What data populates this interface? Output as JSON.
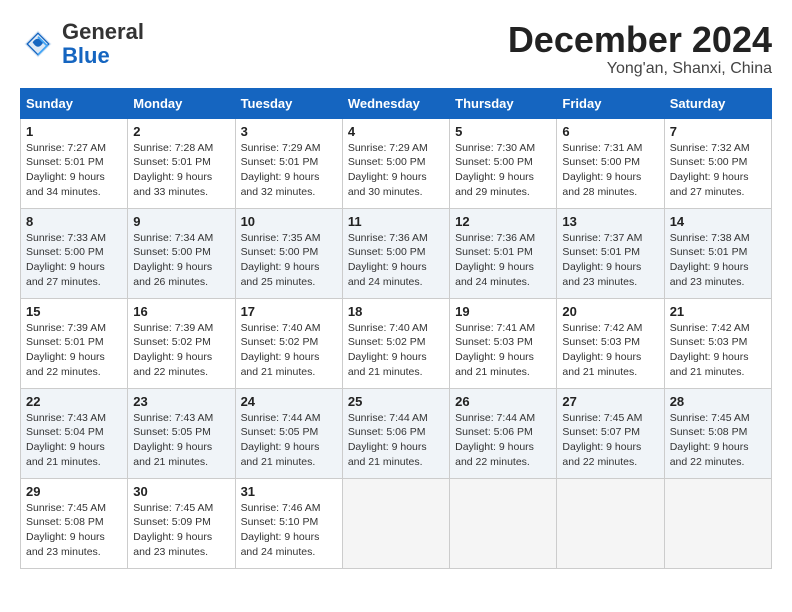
{
  "header": {
    "logo_line1": "General",
    "logo_line2": "Blue",
    "month_title": "December 2024",
    "location": "Yong'an, Shanxi, China"
  },
  "weekdays": [
    "Sunday",
    "Monday",
    "Tuesday",
    "Wednesday",
    "Thursday",
    "Friday",
    "Saturday"
  ],
  "weeks": [
    [
      {
        "day": "1",
        "info": "Sunrise: 7:27 AM\nSunset: 5:01 PM\nDaylight: 9 hours\nand 34 minutes."
      },
      {
        "day": "2",
        "info": "Sunrise: 7:28 AM\nSunset: 5:01 PM\nDaylight: 9 hours\nand 33 minutes."
      },
      {
        "day": "3",
        "info": "Sunrise: 7:29 AM\nSunset: 5:01 PM\nDaylight: 9 hours\nand 32 minutes."
      },
      {
        "day": "4",
        "info": "Sunrise: 7:29 AM\nSunset: 5:00 PM\nDaylight: 9 hours\nand 30 minutes."
      },
      {
        "day": "5",
        "info": "Sunrise: 7:30 AM\nSunset: 5:00 PM\nDaylight: 9 hours\nand 29 minutes."
      },
      {
        "day": "6",
        "info": "Sunrise: 7:31 AM\nSunset: 5:00 PM\nDaylight: 9 hours\nand 28 minutes."
      },
      {
        "day": "7",
        "info": "Sunrise: 7:32 AM\nSunset: 5:00 PM\nDaylight: 9 hours\nand 27 minutes."
      }
    ],
    [
      {
        "day": "8",
        "info": "Sunrise: 7:33 AM\nSunset: 5:00 PM\nDaylight: 9 hours\nand 27 minutes."
      },
      {
        "day": "9",
        "info": "Sunrise: 7:34 AM\nSunset: 5:00 PM\nDaylight: 9 hours\nand 26 minutes."
      },
      {
        "day": "10",
        "info": "Sunrise: 7:35 AM\nSunset: 5:00 PM\nDaylight: 9 hours\nand 25 minutes."
      },
      {
        "day": "11",
        "info": "Sunrise: 7:36 AM\nSunset: 5:00 PM\nDaylight: 9 hours\nand 24 minutes."
      },
      {
        "day": "12",
        "info": "Sunrise: 7:36 AM\nSunset: 5:01 PM\nDaylight: 9 hours\nand 24 minutes."
      },
      {
        "day": "13",
        "info": "Sunrise: 7:37 AM\nSunset: 5:01 PM\nDaylight: 9 hours\nand 23 minutes."
      },
      {
        "day": "14",
        "info": "Sunrise: 7:38 AM\nSunset: 5:01 PM\nDaylight: 9 hours\nand 23 minutes."
      }
    ],
    [
      {
        "day": "15",
        "info": "Sunrise: 7:39 AM\nSunset: 5:01 PM\nDaylight: 9 hours\nand 22 minutes."
      },
      {
        "day": "16",
        "info": "Sunrise: 7:39 AM\nSunset: 5:02 PM\nDaylight: 9 hours\nand 22 minutes."
      },
      {
        "day": "17",
        "info": "Sunrise: 7:40 AM\nSunset: 5:02 PM\nDaylight: 9 hours\nand 21 minutes."
      },
      {
        "day": "18",
        "info": "Sunrise: 7:40 AM\nSunset: 5:02 PM\nDaylight: 9 hours\nand 21 minutes."
      },
      {
        "day": "19",
        "info": "Sunrise: 7:41 AM\nSunset: 5:03 PM\nDaylight: 9 hours\nand 21 minutes."
      },
      {
        "day": "20",
        "info": "Sunrise: 7:42 AM\nSunset: 5:03 PM\nDaylight: 9 hours\nand 21 minutes."
      },
      {
        "day": "21",
        "info": "Sunrise: 7:42 AM\nSunset: 5:03 PM\nDaylight: 9 hours\nand 21 minutes."
      }
    ],
    [
      {
        "day": "22",
        "info": "Sunrise: 7:43 AM\nSunset: 5:04 PM\nDaylight: 9 hours\nand 21 minutes."
      },
      {
        "day": "23",
        "info": "Sunrise: 7:43 AM\nSunset: 5:05 PM\nDaylight: 9 hours\nand 21 minutes."
      },
      {
        "day": "24",
        "info": "Sunrise: 7:44 AM\nSunset: 5:05 PM\nDaylight: 9 hours\nand 21 minutes."
      },
      {
        "day": "25",
        "info": "Sunrise: 7:44 AM\nSunset: 5:06 PM\nDaylight: 9 hours\nand 21 minutes."
      },
      {
        "day": "26",
        "info": "Sunrise: 7:44 AM\nSunset: 5:06 PM\nDaylight: 9 hours\nand 22 minutes."
      },
      {
        "day": "27",
        "info": "Sunrise: 7:45 AM\nSunset: 5:07 PM\nDaylight: 9 hours\nand 22 minutes."
      },
      {
        "day": "28",
        "info": "Sunrise: 7:45 AM\nSunset: 5:08 PM\nDaylight: 9 hours\nand 22 minutes."
      }
    ],
    [
      {
        "day": "29",
        "info": "Sunrise: 7:45 AM\nSunset: 5:08 PM\nDaylight: 9 hours\nand 23 minutes."
      },
      {
        "day": "30",
        "info": "Sunrise: 7:45 AM\nSunset: 5:09 PM\nDaylight: 9 hours\nand 23 minutes."
      },
      {
        "day": "31",
        "info": "Sunrise: 7:46 AM\nSunset: 5:10 PM\nDaylight: 9 hours\nand 24 minutes."
      },
      {
        "day": "",
        "info": ""
      },
      {
        "day": "",
        "info": ""
      },
      {
        "day": "",
        "info": ""
      },
      {
        "day": "",
        "info": ""
      }
    ]
  ]
}
